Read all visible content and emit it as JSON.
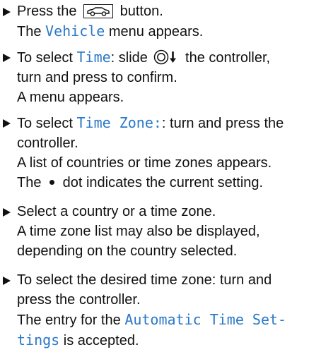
{
  "steps": [
    {
      "line1_pre": "Press the",
      "line1_post": "button.",
      "line2_pre": "The",
      "line2_hl": "Vehicle",
      "line2_post": "menu appears."
    },
    {
      "line1_pre": "To select",
      "line1_hl": "Time",
      "line1_mid": ": slide",
      "line1_post": "the controller,",
      "line2": "turn and press to confirm.",
      "line3": "A menu appears."
    },
    {
      "line1_pre": "To select",
      "line1_hl": "Time Zone:",
      "line1_post": ": turn and press the",
      "line2": "controller.",
      "line3": "A list of countries or time zones appears.",
      "line4_pre": "The",
      "line4_post": "dot indicates the current setting."
    },
    {
      "line1": "Select a country or a time zone.",
      "line2": "A time zone list may also be displayed,",
      "line3": "depending on the country selected."
    },
    {
      "line1": "To select the desired time zone: turn and",
      "line2": "press the controller.",
      "line3_pre": "The entry for the",
      "line3_hl": "Automatic Time Set-",
      "line4_hl": "tings",
      "line4_post": "is accepted."
    }
  ],
  "icons": {
    "vehicle_button": "car-button-icon",
    "controller": "controller-slide-down-icon",
    "bullet_dot": "current-setting-dot-icon",
    "step_marker": "triangle-bullet-icon"
  },
  "colors": {
    "highlight": "#2a78c8",
    "text": "#111111"
  }
}
